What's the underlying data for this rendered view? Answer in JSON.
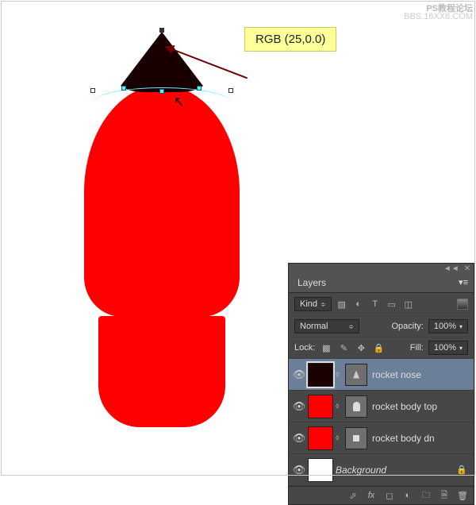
{
  "callout": {
    "text": "RGB (25,0.0)"
  },
  "watermark": {
    "top": "PS教程论坛",
    "bottom": "BBS.16XX8.COM"
  },
  "panel": {
    "tab_layers": "Layers",
    "filter_label": "Kind",
    "blend_mode": "Normal",
    "opacity_label": "Opacity:",
    "opacity_value": "100%",
    "lock_label": "Lock:",
    "fill_label": "Fill:",
    "fill_value": "100%"
  },
  "layers": [
    {
      "name": "rocket nose",
      "thumb_color": "#1a0000",
      "selected": true
    },
    {
      "name": "rocket body top",
      "thumb_color": "#ff0000",
      "selected": false
    },
    {
      "name": "rocket body dn",
      "thumb_color": "#ff0000",
      "selected": false
    },
    {
      "name": "Background",
      "thumb_color": "#ffffff",
      "selected": false,
      "locked": true
    }
  ]
}
